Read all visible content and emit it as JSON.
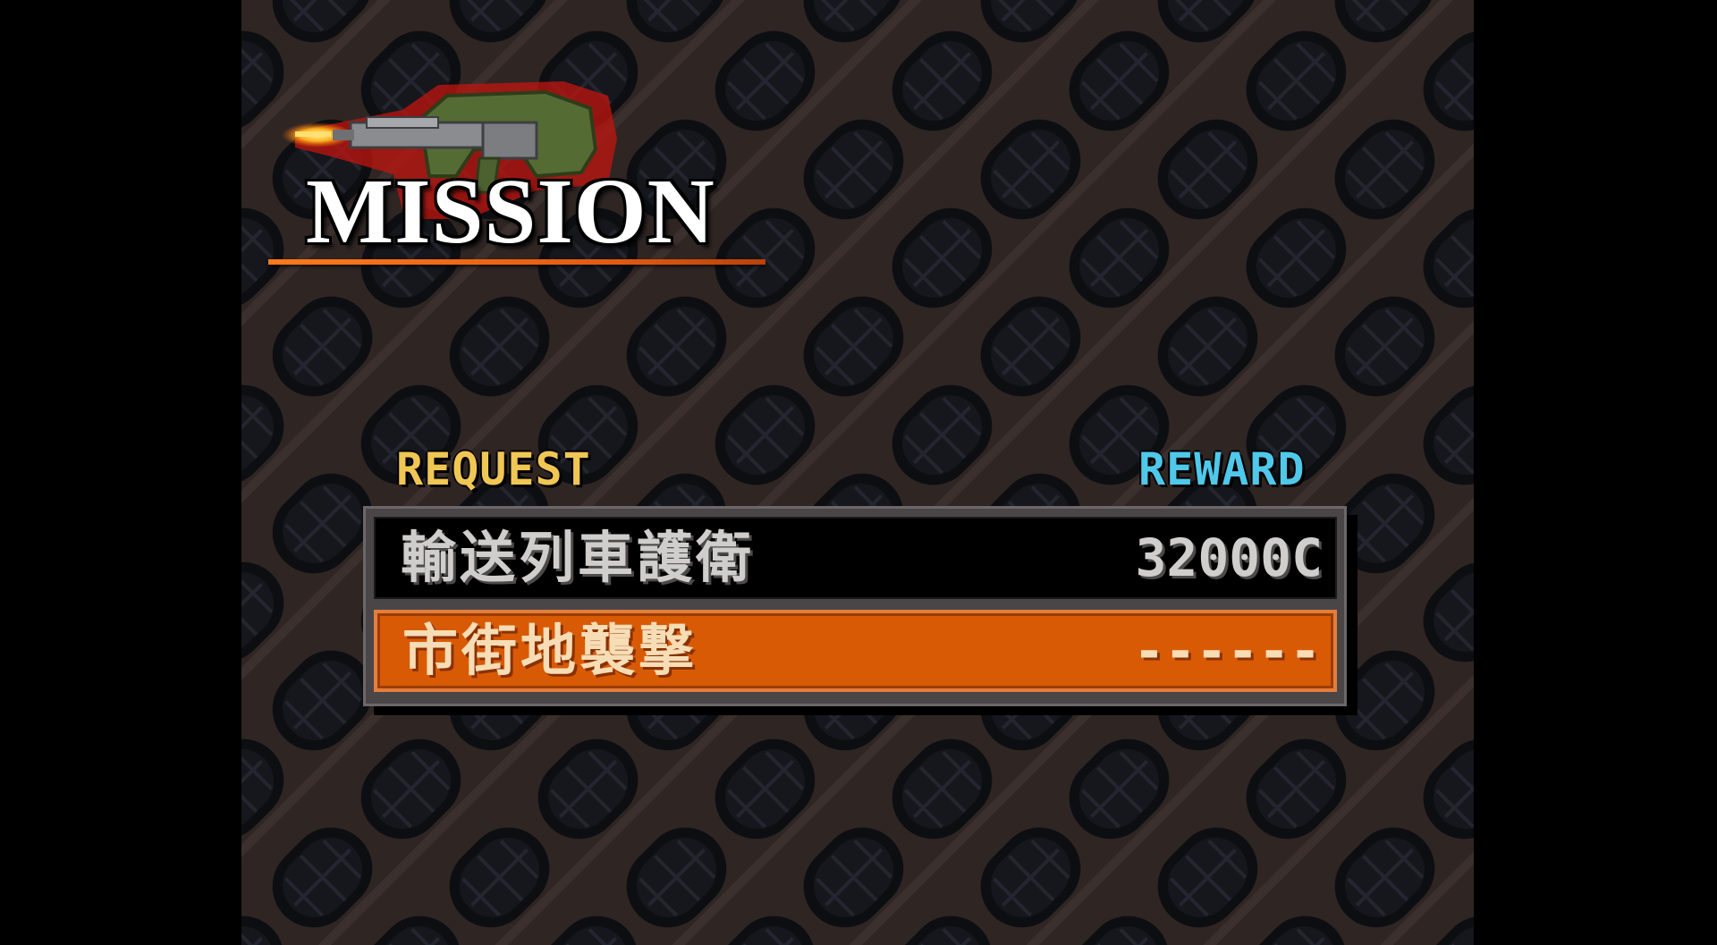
{
  "screen": {
    "title": "MISSION",
    "icon": "assault-rifle-icon"
  },
  "columns": {
    "request_label": "REQUEST",
    "reward_label": "REWARD"
  },
  "missions": [
    {
      "name": "輸送列車護衛",
      "reward": "32000C",
      "selected": false
    },
    {
      "name": "市街地襲撃",
      "reward": "------",
      "selected": true
    }
  ],
  "colors": {
    "request_header": "#f0c654",
    "reward_header": "#4fc8ea",
    "selected_row": "#d95a05",
    "title_underline": "#ff7a1a"
  }
}
